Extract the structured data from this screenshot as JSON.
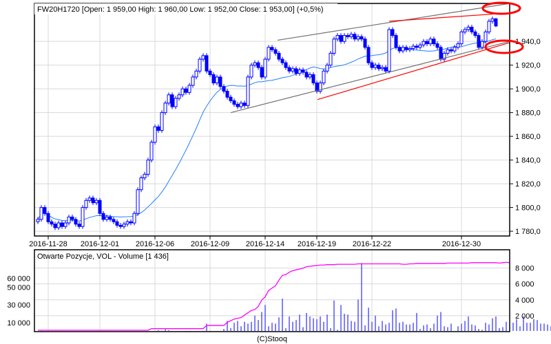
{
  "chart_data": {
    "type": "candlestick",
    "title": "FW20H1720 [Open: 1 959,00  High: 1 960,00  Low: 1 952,00  Close: 1 953,00] (+0,5%)",
    "last_candle": {
      "open": 1959,
      "high": 1960,
      "low": 1952,
      "close": 1953
    },
    "price_axis": {
      "ylim": [
        1776,
        1972
      ],
      "ticks": [
        1780,
        1800,
        1820,
        1840,
        1860,
        1880,
        1900,
        1920,
        1940
      ],
      "tick_labels": [
        "1 780,0",
        "1 800,0",
        "1 820,0",
        "1 840,0",
        "1 860,0",
        "1 880,0",
        "1 900,0",
        "1 920,0",
        "1 940,0"
      ],
      "grid": true,
      "position": "right"
    },
    "x_axis": {
      "count": 134,
      "ticks": [
        {
          "index": 3,
          "label": "2016-11-28"
        },
        {
          "index": 18,
          "label": "2016-12-01"
        },
        {
          "index": 34,
          "label": "2016-12-06"
        },
        {
          "index": 50,
          "label": "2016-12-09"
        },
        {
          "index": 66,
          "label": "2016-12-14"
        },
        {
          "index": 81,
          "label": "2016-12-19"
        },
        {
          "index": 97,
          "label": "2016-12-22"
        },
        {
          "index": 123,
          "label": "2016-12-30"
        }
      ]
    },
    "close": [
      1790,
      1800,
      1795,
      1788,
      1786,
      1783,
      1787,
      1784,
      1787,
      1792,
      1790,
      1786,
      1784,
      1800,
      1806,
      1808,
      1804,
      1806,
      1795,
      1790,
      1792,
      1790,
      1788,
      1785,
      1784,
      1786,
      1788,
      1787,
      1795,
      1815,
      1825,
      1828,
      1840,
      1855,
      1868,
      1865,
      1880,
      1888,
      1895,
      1885,
      1892,
      1895,
      1900,
      1897,
      1903,
      1910,
      1915,
      1925,
      1928,
      1915,
      1912,
      1905,
      1910,
      1902,
      1898,
      1893,
      1890,
      1887,
      1885,
      1888,
      1886,
      1910,
      1920,
      1922,
      1918,
      1910,
      1925,
      1935,
      1933,
      1930,
      1925,
      1922,
      1918,
      1915,
      1917,
      1913,
      1916,
      1914,
      1910,
      1912,
      1905,
      1898,
      1905,
      1915,
      1920,
      1930,
      1942,
      1945,
      1940,
      1945,
      1944,
      1946,
      1942,
      1944,
      1942,
      1935,
      1922,
      1918,
      1920,
      1917,
      1918,
      1915,
      1950,
      1945,
      1935,
      1932,
      1935,
      1933,
      1934,
      1936,
      1935,
      1937,
      1940,
      1938,
      1942,
      1938,
      1935,
      1925,
      1930,
      1933,
      1932,
      1935,
      1938,
      1948,
      1950,
      1952,
      1948,
      1945,
      1935,
      1940,
      1948,
      1957,
      1959,
      1953
    ],
    "moving_average_period": 20,
    "trend_lines": [
      {
        "color": "#707070",
        "from": [
          69.6,
          1941
        ],
        "to": [
          137,
          1972
        ]
      },
      {
        "color": "#707070",
        "from": [
          56,
          1880
        ],
        "to": [
          137,
          1940
        ]
      },
      {
        "color": "#ff0000",
        "from": [
          81.2,
          1891
        ],
        "to": [
          137,
          1939
        ]
      },
      {
        "color": "#ff0000",
        "from": [
          102,
          1957
        ],
        "to": [
          137,
          1964
        ]
      }
    ],
    "volume_panel": {
      "title": "Otwarte Pozycje, VOL - Volume [1 436]",
      "volume_axis": {
        "ylim": [
          0,
          92000
        ],
        "ticks": [
          10000,
          30000,
          50000,
          60000
        ],
        "tick_labels": [
          "10 000",
          "30 000",
          "50 000",
          "60 000"
        ],
        "position": "left"
      },
      "oi_axis": {
        "ylim": [
          0,
          10300
        ],
        "ticks": [
          2000,
          4000,
          6000,
          8000
        ],
        "tick_labels": [
          "2 000",
          "4 000",
          "6 000",
          "8 000"
        ],
        "position": "right"
      },
      "volume": [
        0,
        500,
        0,
        0,
        0,
        0,
        0,
        0,
        0,
        0,
        0,
        0,
        0,
        0,
        0,
        0,
        0,
        0,
        0,
        0,
        0,
        0,
        0,
        0,
        0,
        0,
        0,
        0,
        0,
        0,
        0,
        0,
        0,
        0,
        0,
        1500,
        1000,
        2500,
        1500,
        0,
        0,
        0,
        0,
        500,
        500,
        0,
        0,
        0,
        500,
        9000,
        500,
        0,
        0,
        0,
        3000,
        12000,
        4000,
        10000,
        12000,
        6000,
        11000,
        9000,
        11000,
        18000,
        13000,
        22000,
        30000,
        6000,
        10000,
        9000,
        16000,
        37000,
        4000,
        17000,
        11000,
        13000,
        19000,
        5000,
        21000,
        17000,
        15000,
        14000,
        17000,
        11000,
        19000,
        4000,
        35000,
        2000,
        30000,
        20000,
        19000,
        12000,
        11000,
        36000,
        77000,
        7000,
        27000,
        11000,
        18000,
        6000,
        12000,
        8000,
        10000,
        24000,
        26000,
        10000,
        11000,
        8000,
        8000,
        10000,
        21000,
        3000,
        7000,
        8000,
        4000,
        9000,
        18000,
        22000,
        6000,
        5000,
        9000,
        0,
        6000,
        9000,
        12000,
        17000,
        8000,
        7000,
        3000,
        2000,
        10000,
        8000,
        15000,
        17000,
        4000,
        5000,
        11000,
        6000,
        10000,
        14000,
        6000,
        17000,
        10000,
        10000,
        14000,
        13000,
        9000,
        9000,
        8000,
        6000,
        9000,
        11000
      ],
      "open_interest": [
        0,
        0,
        0,
        0,
        0,
        0,
        0,
        0,
        0,
        0,
        0,
        0,
        0,
        0,
        0,
        0,
        0,
        0,
        0,
        0,
        0,
        0,
        0,
        0,
        0,
        0,
        0,
        0,
        0,
        0,
        0,
        0,
        0,
        200,
        200,
        200,
        200,
        200,
        200,
        200,
        200,
        200,
        200,
        200,
        200,
        200,
        200,
        200,
        200,
        600,
        600,
        600,
        600,
        600,
        600,
        1000,
        1200,
        1400,
        1500,
        1600,
        1900,
        2200,
        2500,
        2600,
        3000,
        3800,
        4200,
        5000,
        5300,
        5600,
        6300,
        6900,
        7000,
        7300,
        7500,
        7600,
        7700,
        7800,
        8000,
        8050,
        8100,
        8150,
        8200,
        8200,
        8250,
        8250,
        8250,
        8300,
        8300,
        8300,
        8300,
        8300,
        8300,
        8350,
        8350,
        8350,
        8350,
        8350,
        8350,
        8350,
        8350,
        8350,
        8350,
        8350,
        8350,
        8350,
        8300,
        8300,
        8350,
        8350,
        8400,
        8400,
        8400,
        8400,
        8400,
        8400,
        8400,
        8400,
        8400,
        8450,
        8450,
        8450,
        8450,
        8450,
        8450,
        8450,
        8500,
        8500,
        8500,
        8500,
        8500,
        8500,
        8500,
        8500,
        8450,
        8500,
        8550,
        8500
      ]
    },
    "colors": {
      "candle": "#0000ff",
      "moving_average": "#1e7fff",
      "open_interest": "#ff00ff",
      "volume": "#0000ff",
      "grid": "#d8d8d8",
      "annotation": "#ff0000"
    }
  },
  "footer": {
    "copyright": "(C)Stooq"
  }
}
